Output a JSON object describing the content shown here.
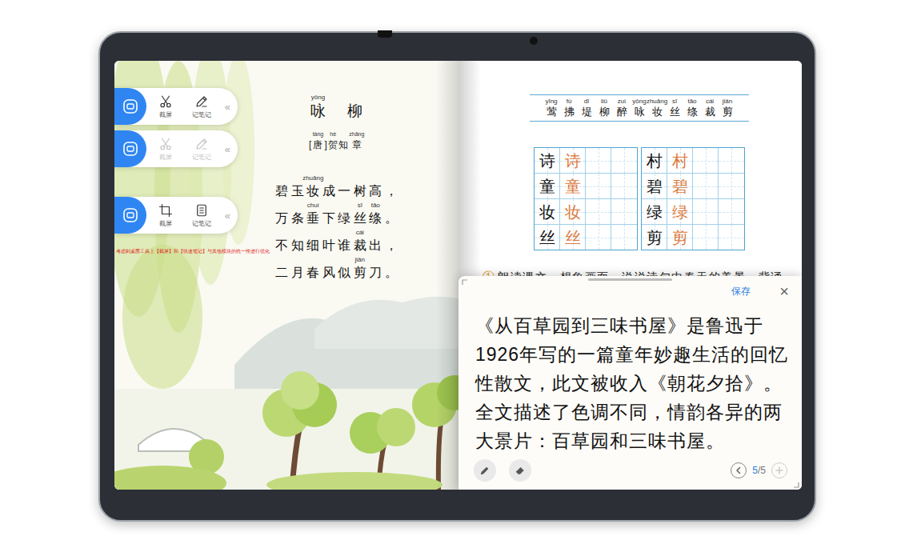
{
  "toolbars": [
    {
      "disabled": false,
      "collapse": "«",
      "tools": [
        {
          "kind": "scissors",
          "label": "截屏"
        },
        {
          "kind": "pen",
          "label": "记笔记"
        }
      ]
    },
    {
      "disabled": true,
      "collapse": "«",
      "tools": [
        {
          "kind": "scissors",
          "label": "截屏"
        },
        {
          "kind": "pen",
          "label": "记笔记"
        }
      ]
    },
    {
      "disabled": false,
      "collapse": "«",
      "tools": [
        {
          "kind": "crop",
          "label": "截屏"
        },
        {
          "kind": "notes",
          "label": "记笔记"
        }
      ]
    }
  ],
  "annotation": "考虑到桌面工具上【截屏】和【快速笔记】与其他模块的统一性进行优化",
  "poem": {
    "title": [
      {
        "char": "咏",
        "pinyin": "yǒng"
      },
      {
        "char": "柳"
      }
    ],
    "author": [
      {
        "char": "["
      },
      {
        "char": "唐",
        "pinyin": "táng"
      },
      {
        "char": "]"
      },
      {
        "char": "贺",
        "pinyin": "hè"
      },
      {
        "char": "知"
      },
      {
        "char": "章",
        "pinyin": "zhāng"
      }
    ],
    "lines": [
      {
        "units": [
          {
            "char": "碧"
          },
          {
            "char": "玉"
          },
          {
            "char": "妆",
            "pinyin": "zhuāng"
          },
          {
            "char": "成"
          },
          {
            "char": "一"
          },
          {
            "char": "树"
          },
          {
            "char": "高"
          },
          {
            "char": "，"
          }
        ]
      },
      {
        "units": [
          {
            "char": "万"
          },
          {
            "char": "条"
          },
          {
            "char": "垂",
            "pinyin": "chuí"
          },
          {
            "char": "下"
          },
          {
            "char": "绿"
          },
          {
            "char": "丝",
            "pinyin": "sī"
          },
          {
            "char": "绦",
            "pinyin": "tāo"
          },
          {
            "char": "。"
          }
        ]
      },
      {
        "units": [
          {
            "char": "不"
          },
          {
            "char": "知"
          },
          {
            "char": "细"
          },
          {
            "char": "叶"
          },
          {
            "char": "谁"
          },
          {
            "char": "裁",
            "pinyin": "cái"
          },
          {
            "char": "出"
          },
          {
            "char": "，"
          }
        ]
      },
      {
        "units": [
          {
            "char": "二"
          },
          {
            "char": "月"
          },
          {
            "char": "春"
          },
          {
            "char": "风"
          },
          {
            "char": "似"
          },
          {
            "char": "剪",
            "pinyin": "jiǎn"
          },
          {
            "char": "刀"
          },
          {
            "char": "。"
          }
        ]
      }
    ]
  },
  "vocabulary": [
    {
      "char": "莺",
      "pinyin": "yīng"
    },
    {
      "char": "拂",
      "pinyin": "fú"
    },
    {
      "char": "堤",
      "pinyin": "dī"
    },
    {
      "char": "柳",
      "pinyin": "liǔ"
    },
    {
      "char": "醉",
      "pinyin": "zuì"
    },
    {
      "char": "咏",
      "pinyin": "yǒng"
    },
    {
      "char": "妆",
      "pinyin": "zhuāng"
    },
    {
      "char": "丝",
      "pinyin": "sī"
    },
    {
      "char": "绦",
      "pinyin": "tāo"
    },
    {
      "char": "裁",
      "pinyin": "cái"
    },
    {
      "char": "剪",
      "pinyin": "jiǎn"
    }
  ],
  "practice": [
    {
      "rows": [
        {
          "model": "诗",
          "trace": "诗"
        },
        {
          "model": "童",
          "trace": "童"
        },
        {
          "model": "妆",
          "trace": "妆"
        },
        {
          "model": "丝",
          "trace": "丝"
        }
      ]
    },
    {
      "rows": [
        {
          "model": "村",
          "trace": "村"
        },
        {
          "model": "碧",
          "trace": "碧"
        },
        {
          "model": "绿",
          "trace": "绿"
        },
        {
          "model": "剪",
          "trace": "剪"
        }
      ]
    }
  ],
  "exercise": {
    "number": "①",
    "text": "朗读课文，想象画面，说说诗句中春天的美景。背诵"
  },
  "note": {
    "save": "保存",
    "close": "×",
    "body": "《从百草园到三味书屋》是鲁迅于1926年写的一篇童年妙趣生活的回忆性散文，此文被收入《朝花夕拾》。全文描述了色调不同，情韵各异的两大景片：百草园和三味书屋。",
    "tools": [
      {
        "kind": "pen"
      },
      {
        "kind": "eraser"
      }
    ],
    "pager": {
      "current": "5",
      "divider": "/",
      "total": "5",
      "prev_disabled": false,
      "next_disabled": true
    }
  }
}
